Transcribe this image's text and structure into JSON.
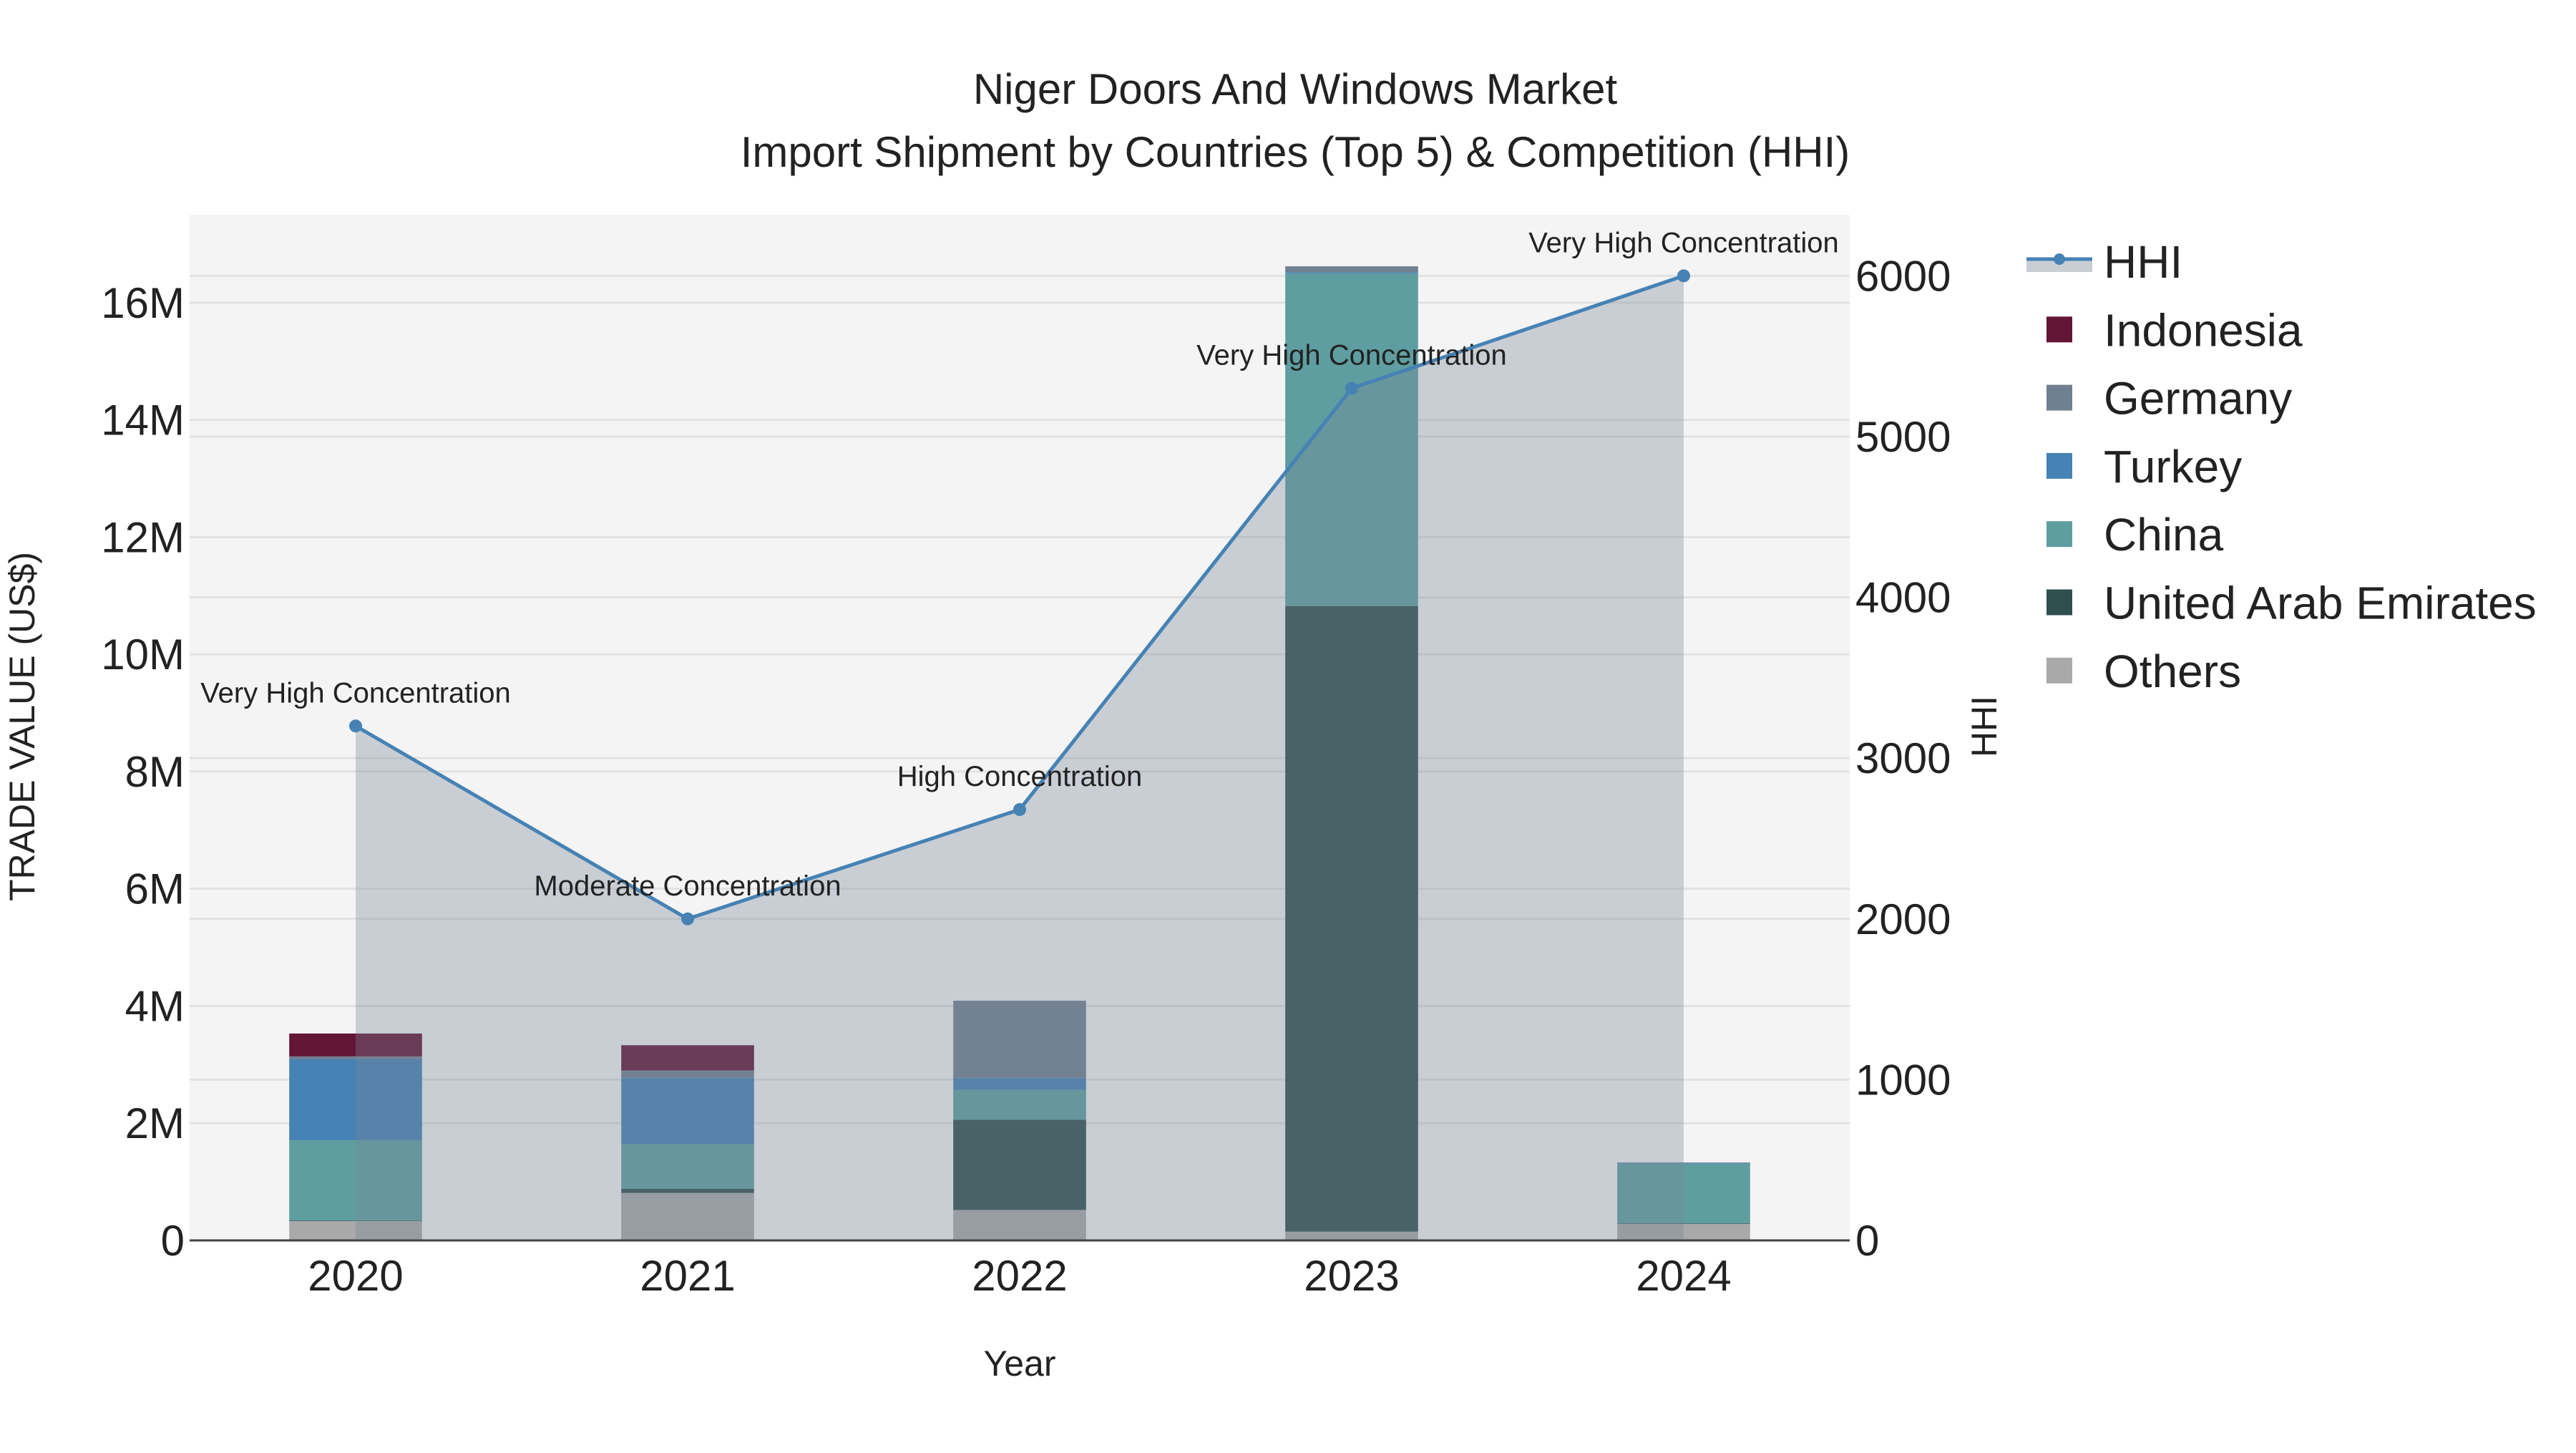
{
  "chart_data": {
    "type": "bar",
    "title": "Niger Doors And Windows Market",
    "subtitle": "Import Shipment by Countries (Top 5) & Competition (HHI)",
    "xlabel": "Year",
    "ylabel": "TRADE VALUE (US$)",
    "y2label": "HHI",
    "categories": [
      "2020",
      "2021",
      "2022",
      "2023",
      "2024"
    ],
    "ylim": [
      0,
      17.5
    ],
    "y_unit": "M",
    "yticks": [
      0,
      2,
      4,
      6,
      8,
      10,
      12,
      14,
      16
    ],
    "ytick_labels": [
      "0",
      "2M",
      "4M",
      "6M",
      "8M",
      "10M",
      "12M",
      "14M",
      "16M"
    ],
    "y2lim": [
      0,
      6380
    ],
    "y2ticks": [
      0,
      1000,
      2000,
      3000,
      4000,
      5000,
      6000
    ],
    "y2tick_labels": [
      "0",
      "1000",
      "2000",
      "3000",
      "4000",
      "5000",
      "6000"
    ],
    "grid": true,
    "legend_position": "right",
    "series": [
      {
        "name": "Others",
        "color": "#A9A9A9",
        "values": [
          0.33,
          0.81,
          0.52,
          0.15,
          0.28
        ]
      },
      {
        "name": "United Arab Emirates",
        "color": "#2F4F4F",
        "values": [
          0.01,
          0.07,
          1.54,
          10.67,
          0.01
        ]
      },
      {
        "name": "China",
        "color": "#5F9EA0",
        "values": [
          1.37,
          0.76,
          0.51,
          5.68,
          1.02
        ]
      },
      {
        "name": "Turkey",
        "color": "#4682B4",
        "values": [
          1.38,
          1.13,
          0.2,
          0.02,
          0.01
        ]
      },
      {
        "name": "Germany",
        "color": "#708090",
        "values": [
          0.05,
          0.13,
          1.32,
          0.1,
          0.01
        ]
      },
      {
        "name": "Indonesia",
        "color": "#631536",
        "values": [
          0.39,
          0.43,
          0,
          0,
          0
        ]
      }
    ],
    "hhi": {
      "name": "HHI",
      "color": "#4682B4",
      "fill": "rgba(119,136,153,0.35)",
      "values": [
        3200,
        2000,
        2680,
        5300,
        6000
      ],
      "annotations": [
        "Very High Concentration",
        "Moderate Concentration",
        "High Concentration",
        "Very High Concentration",
        "Very High Concentration"
      ]
    },
    "legend_order": [
      "HHI",
      "Indonesia",
      "Germany",
      "Turkey",
      "China",
      "United Arab Emirates",
      "Others"
    ]
  }
}
